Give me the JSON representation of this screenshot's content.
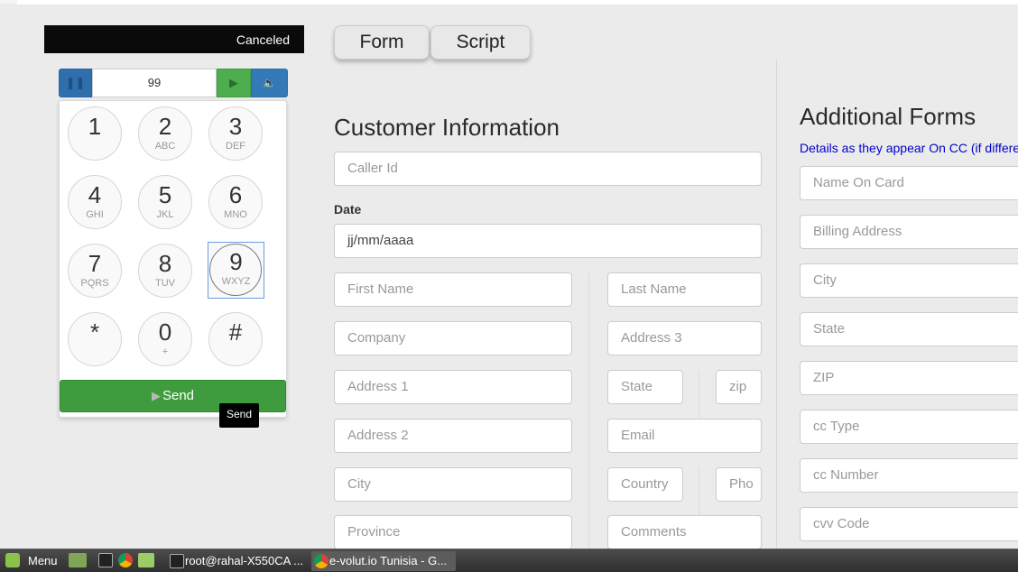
{
  "status": {
    "text": "Canceled"
  },
  "player": {
    "number": "99",
    "left_icon": "pause-icon",
    "play_icon": "play-icon",
    "volume_icon": "volume-icon"
  },
  "dialpad": {
    "keys": [
      {
        "digit": "1",
        "letters": ""
      },
      {
        "digit": "2",
        "letters": "ABC"
      },
      {
        "digit": "3",
        "letters": "DEF"
      },
      {
        "digit": "4",
        "letters": "GHI"
      },
      {
        "digit": "5",
        "letters": "JKL"
      },
      {
        "digit": "6",
        "letters": "MNO"
      },
      {
        "digit": "7",
        "letters": "PQRS"
      },
      {
        "digit": "8",
        "letters": "TUV"
      },
      {
        "digit": "9",
        "letters": "WXYZ"
      },
      {
        "digit": "*",
        "letters": ""
      },
      {
        "digit": "0",
        "letters": "+"
      },
      {
        "digit": "#",
        "letters": ""
      }
    ],
    "send_label": "Send",
    "tooltip": "Send"
  },
  "tabs": [
    {
      "label": "Form"
    },
    {
      "label": "Script"
    }
  ],
  "customer": {
    "title": "Customer Information",
    "caller_id": "Caller Id",
    "date_label": "Date",
    "date_value": "jj/mm/aaaa",
    "first_name": "First Name",
    "last_name": "Last Name",
    "company": "Company",
    "address3": "Address 3",
    "address1": "Address 1",
    "state": "State",
    "zip": "zip",
    "address2": "Address 2",
    "email": "Email",
    "city": "City",
    "country": "Country",
    "phone": "Pho",
    "province": "Province",
    "comments": "Comments"
  },
  "additional": {
    "title": "Additional Forms",
    "subtitle": "Details as they appear On CC (if differe",
    "fields": [
      "Name On Card",
      "Billing Address",
      "City",
      "State",
      "ZIP",
      "cc Type",
      "cc Number",
      "cvv Code"
    ]
  },
  "taskbar": {
    "menu_label": "Menu",
    "windows": [
      {
        "label": "root@rahal-X550CA ...",
        "icon": "terminal-icon"
      },
      {
        "label": "e-volut.io Tunisia - G...",
        "icon": "chrome-icon"
      }
    ]
  }
}
